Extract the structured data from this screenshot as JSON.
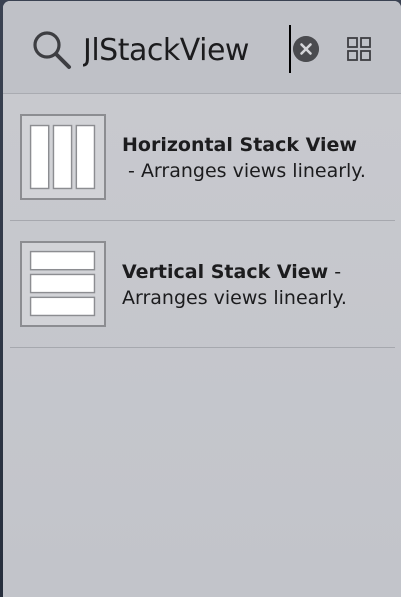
{
  "search": {
    "value": "JlStackView",
    "placeholder": ""
  },
  "icons": {
    "search": "search-icon",
    "clear": "clear-circle-icon",
    "grid": "grid-view-icon",
    "horizontal_stack": "horizontal-stack-view-icon",
    "vertical_stack": "vertical-stack-view-icon"
  },
  "results": [
    {
      "title": "Horizontal Stack View",
      "separator": " - ",
      "description": "Arranges views linearly."
    },
    {
      "title": "Vertical Stack View",
      "separator": " - ",
      "description": "Arranges views linearly."
    }
  ],
  "colors": {
    "panel": "#c6c8cd",
    "separator": "#a6a8ae",
    "text": "#1c1c1e"
  }
}
